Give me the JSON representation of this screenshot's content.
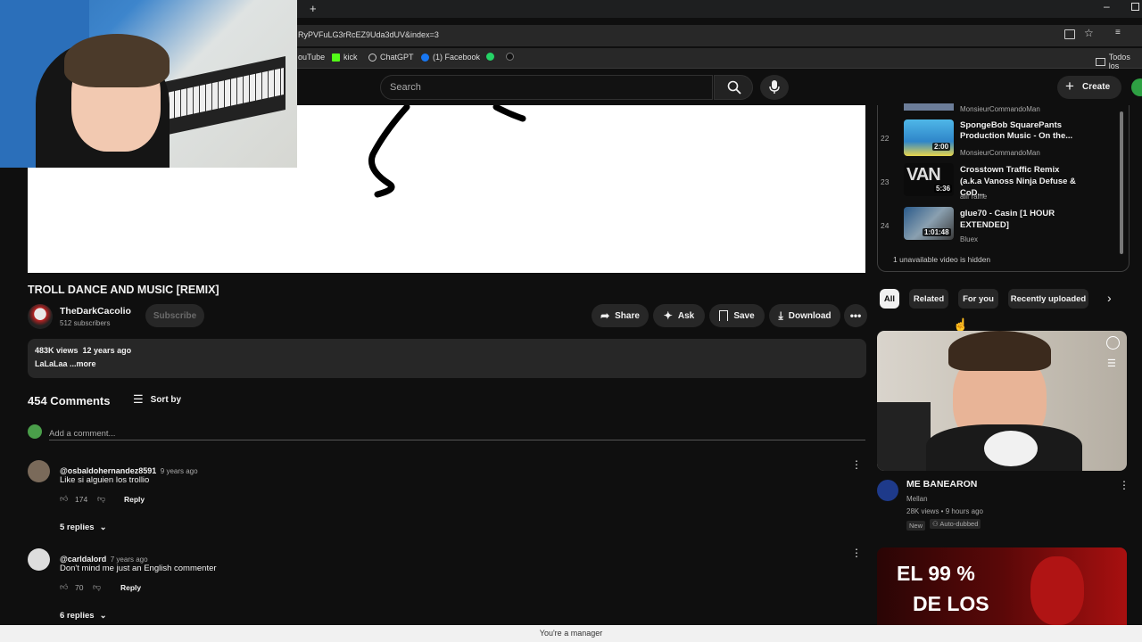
{
  "browser": {
    "url_fragment": "RyPVFuLG3rRcEZ9Uda3dUV&index=3",
    "bookmarks": [
      {
        "label": "ouTube",
        "icon": "youtube-icon"
      },
      {
        "label": "kick",
        "icon": "kick-icon"
      },
      {
        "label": "ChatGPT",
        "icon": "chatgpt-icon"
      },
      {
        "label": "(1) Facebook",
        "icon": "facebook-icon"
      },
      {
        "label": "",
        "icon": "whatsapp-icon"
      },
      {
        "label": "",
        "icon": "tiktok-icon"
      }
    ],
    "all_bookmarks": "Todos los"
  },
  "header": {
    "search_placeholder": "Search",
    "create_label": "Create"
  },
  "video": {
    "title": "TROLL DANCE AND MUSIC [REMIX]",
    "channel": "TheDarkCacolio",
    "subscribers": "512 subscribers",
    "subscribe_label": "Subscribe",
    "actions": {
      "share": "Share",
      "ask": "Ask",
      "save": "Save",
      "download": "Download"
    },
    "views_date": "483K views  12 years ago",
    "description": "LaLaLaa ...more"
  },
  "comments": {
    "count": "454 Comments",
    "sort_label": "Sort by",
    "add_placeholder": "Add a comment...",
    "items": [
      {
        "author": "@osbaldohernandez8591",
        "time": "9 years ago",
        "text": "Like si alguien los trollio",
        "likes": "174",
        "reply": "Reply",
        "replies": "5 replies"
      },
      {
        "author": "@carldalord",
        "time": "7 years ago",
        "text": "Don't mind me just an English commenter",
        "likes": "70",
        "reply": "Reply",
        "replies": "6 replies"
      }
    ]
  },
  "playlist": {
    "items": [
      {
        "index": "",
        "title": "",
        "channel": "MonsieurCommandoMan",
        "duration": ""
      },
      {
        "index": "22",
        "title": "SpongeBob SquarePants Production Music - On the...",
        "channel": "MonsieurCommandoMan",
        "duration": "2:00"
      },
      {
        "index": "23",
        "title": "Crosstown Traffic Remix (a.k.a Vanoss Ninja Defuse & CoD...",
        "channel": "alif raine",
        "duration": "5:36"
      },
      {
        "index": "24",
        "title": "glue70 - Casin [1 HOUR EXTENDED]",
        "channel": "Bluex",
        "duration": "1:01:48"
      }
    ],
    "hidden_note": "1 unavailable video is hidden"
  },
  "chips": [
    "All",
    "Related",
    "For you",
    "Recently uploaded"
  ],
  "recommended": [
    {
      "title": "ME BANEARON",
      "channel": "Mellan",
      "meta": "28K views • 9 hours ago",
      "badge_new": "New",
      "badge_dub": "Auto-dubbed"
    },
    {
      "thumb_text_1": "EL 99 %",
      "thumb_text_2": "DE LOS"
    }
  ],
  "status_bar": "You're a manager",
  "colors": {
    "background": "#0f0f0f",
    "surface": "#272727",
    "accent": "#3ea6ff"
  }
}
